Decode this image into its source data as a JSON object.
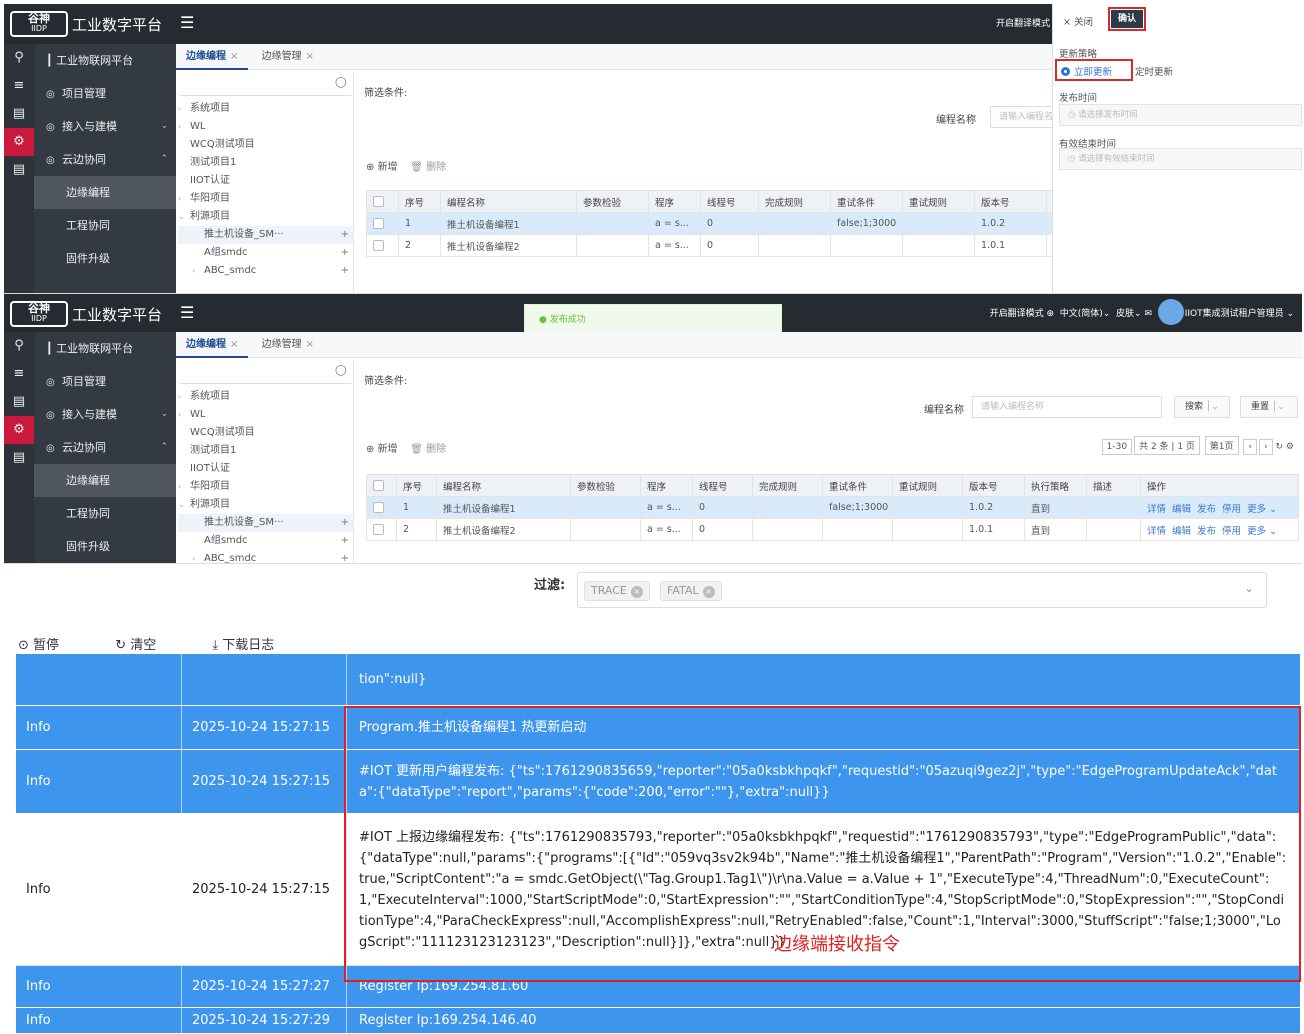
{
  "app": {
    "logo_main": "谷神",
    "logo_sub": "IIDP",
    "title": "工业数字平台"
  },
  "header": {
    "translate_mode": "开启翻译模式",
    "language": "中文(简体)",
    "skin": "皮肤",
    "user": "IIOT集成测试租户管理员"
  },
  "sidebar": {
    "platform": "工业物联网平台",
    "items": [
      {
        "label": "项目管理"
      },
      {
        "label": "接入与建模"
      },
      {
        "label": "云边协同"
      }
    ],
    "subitems": [
      {
        "label": "边缘编程"
      },
      {
        "label": "工程协同"
      },
      {
        "label": "固件升级"
      }
    ]
  },
  "tabs": [
    {
      "label": "边缘编程",
      "close": "×"
    },
    {
      "label": "边缘管理",
      "close": "×"
    }
  ],
  "tree": {
    "nodes": [
      {
        "label": "系统项目"
      },
      {
        "label": "WL"
      },
      {
        "label": "WCQ测试项目"
      },
      {
        "label": "测试项目1"
      },
      {
        "label": "IIOT认证"
      },
      {
        "label": "华阳项目"
      },
      {
        "label": "利源项目"
      },
      {
        "label": "推土机设备_SM···"
      },
      {
        "label": "A组smdc"
      },
      {
        "label": "ABC_smdc"
      }
    ]
  },
  "filter": {
    "title": "筛选条件:",
    "name_label": "编程名称",
    "name_placeholder": "请输入编程名称",
    "name_placeholder_cut": "请输入编程名",
    "search": "搜索",
    "reset": "重置",
    "add": "新增",
    "delete": "删除"
  },
  "pager": {
    "size": "1-30",
    "total": "共 2 条",
    "pages": "1 页",
    "page": "第1页"
  },
  "table": {
    "headers": [
      "序号",
      "编程名称",
      "参数检验",
      "程序",
      "线程号",
      "完成规则",
      "重试条件",
      "重试规则",
      "版本号",
      "执行策略",
      "描述",
      "操作"
    ],
    "rows": [
      {
        "no": "1",
        "name": "推土机设备编程1",
        "param": "",
        "prog": "a = s...",
        "thread": "0",
        "done": "",
        "retry": "false;1;3000",
        "retry_rule": "",
        "version": "1.0.2",
        "policy": "直到",
        "desc": ""
      },
      {
        "no": "2",
        "name": "推土机设备编程2",
        "param": "",
        "prog": "a = s...",
        "thread": "0",
        "done": "",
        "retry": "",
        "retry_rule": "",
        "version": "1.0.1",
        "policy": "直到",
        "desc": ""
      }
    ],
    "ops": [
      "详情",
      "编辑",
      "发布",
      "停用",
      "更多"
    ]
  },
  "drawer": {
    "close": "关闭",
    "confirm": "确认",
    "strategy_label": "更新策略",
    "opt_now": "立即更新",
    "opt_timed": "定时更新",
    "publish_label": "发布时间",
    "publish_placeholder": "请选择发布时间",
    "end_label": "有效结束时间",
    "end_placeholder": "请选择有效结束时间"
  },
  "toast": {
    "text": "发布成功"
  },
  "log": {
    "filter_label": "过滤:",
    "chips": [
      "TRACE",
      "FATAL"
    ],
    "pause": "暂停",
    "clear": "清空",
    "download": "下载日志",
    "rows": [
      {
        "level": "",
        "time": "",
        "message": "tion\":null}"
      },
      {
        "level": "Info",
        "time": "2025-10-24 15:27:15",
        "message": "Program.推土机设备编程1 热更新启动"
      },
      {
        "level": "Info",
        "time": "2025-10-24 15:27:15",
        "message": "#IOT 更新用户编程发布: {\"ts\":1761290835659,\"reporter\":\"05a0ksbkhpqkf\",\"requestid\":\"05azuqi9gez2j\",\"type\":\"EdgeProgramUpdateAck\",\"data\":{\"dataType\":\"report\",\"params\":{\"code\":200,\"error\":\"\"},\"extra\":null}}"
      },
      {
        "level": "Info",
        "time": "2025-10-24 15:27:15",
        "message": "#IOT 上报边缘编程发布: {\"ts\":1761290835793,\"reporter\":\"05a0ksbkhpqkf\",\"requestid\":\"1761290835793\",\"type\":\"EdgeProgramPublic\",\"data\":{\"dataType\":null,\"params\":{\"programs\":[{\"Id\":\"059vq3sv2k94b\",\"Name\":\"推土机设备编程1\",\"ParentPath\":\"Program\",\"Version\":\"1.0.2\",\"Enable\":true,\"ScriptContent\":\"a = smdc.GetObject(\\\"Tag.Group1.Tag1\\\")\\r\\na.Value = a.Value + 1\",\"ExecuteType\":4,\"ThreadNum\":0,\"ExecuteCount\":1,\"ExecuteInterval\":1000,\"StartScriptMode\":0,\"StartExpression\":\"\",\"StartConditionType\":4,\"StopScriptMode\":0,\"StopExpression\":\"\",\"StopConditionType\":4,\"ParaCheckExpress\":null,\"AccomplishExpress\":null,\"RetryEnabled\":false,\"Count\":1,\"Interval\":3000,\"StuffScript\":\"false;1;3000\",\"LogScript\":\"111123123123123\",\"Description\":null}]},\"extra\":null}}"
      },
      {
        "level": "Info",
        "time": "2025-10-24 15:27:27",
        "message": "Register Ip:169.254.81.60"
      },
      {
        "level": "Info",
        "time": "2025-10-24 15:27:29",
        "message": "Register Ip:169.254.146.40"
      }
    ],
    "annotation": "边缘端接收指令"
  }
}
